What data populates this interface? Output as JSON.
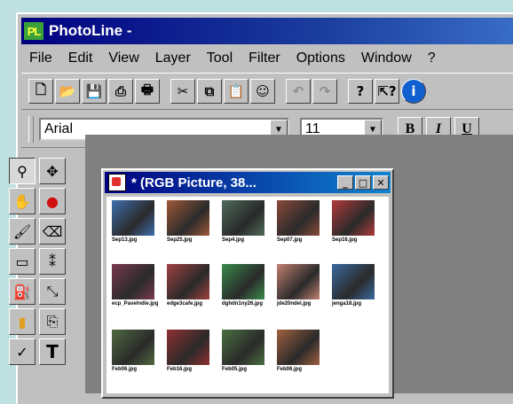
{
  "app": {
    "logo": "PL",
    "title": "PhotoLine -"
  },
  "menu": [
    "File",
    "Edit",
    "View",
    "Layer",
    "Tool",
    "Filter",
    "Options",
    "Window",
    "?"
  ],
  "toolbar": {
    "buttons": [
      {
        "name": "new-file-icon",
        "glyph": "🗋"
      },
      {
        "name": "open-folder-icon",
        "glyph": "📂"
      },
      {
        "name": "save-disk-icon",
        "glyph": "💾"
      },
      {
        "name": "scanner-icon",
        "glyph": "⎙"
      },
      {
        "name": "print-icon",
        "glyph": "🖶"
      },
      {
        "name": "cut-icon",
        "glyph": "✂"
      },
      {
        "name": "copy-icon",
        "glyph": "⧉"
      },
      {
        "name": "paste-icon",
        "glyph": "📋"
      },
      {
        "name": "paste-special-icon",
        "glyph": "☺"
      },
      {
        "name": "undo-icon",
        "glyph": "↶"
      },
      {
        "name": "redo-icon",
        "glyph": "↷"
      },
      {
        "name": "help-icon",
        "glyph": "?"
      },
      {
        "name": "context-help-icon",
        "glyph": "⇱?"
      },
      {
        "name": "info-icon",
        "glyph": "i"
      }
    ]
  },
  "font": {
    "family": "Arial",
    "size": "11",
    "bold": "B",
    "italic": "I",
    "underline": "U"
  },
  "tools": [
    {
      "name": "zoom-tool-icon",
      "glyph": "⚲"
    },
    {
      "name": "move-tool-icon",
      "glyph": "✥"
    },
    {
      "name": "hand-tool-icon",
      "glyph": "✋"
    },
    {
      "name": "lasso-tool-icon",
      "glyph": "●"
    },
    {
      "name": "brush-tool-icon",
      "glyph": "🖌"
    },
    {
      "name": "eraser-tool-icon",
      "glyph": "⌫"
    },
    {
      "name": "rect-select-tool-icon",
      "glyph": "▭"
    },
    {
      "name": "magic-wand-tool-icon",
      "glyph": "⁑"
    },
    {
      "name": "bucket-tool-icon",
      "glyph": "⛽"
    },
    {
      "name": "eyedropper-tool-icon",
      "glyph": "⤡"
    },
    {
      "name": "gradient-tool-icon",
      "glyph": "▮"
    },
    {
      "name": "clone-tool-icon",
      "glyph": "⎘"
    },
    {
      "name": "pen-tool-icon",
      "glyph": "✓"
    },
    {
      "name": "text-tool-icon",
      "glyph": "T"
    }
  ],
  "document": {
    "title": "* (RGB Picture, 38...",
    "minimize": "_",
    "maximize": "□",
    "close": "✕",
    "thumbnails": [
      {
        "caption": "Sep13.jpg",
        "color": "#3f6fb0"
      },
      {
        "caption": "Sep25.jpg",
        "color": "#a05a3a"
      },
      {
        "caption": "Sep4.jpg",
        "color": "#4e6a5a"
      },
      {
        "caption": "Sep07.jpg",
        "color": "#8a4a3a"
      },
      {
        "caption": "Sep16.jpg",
        "color": "#b23a3a"
      },
      {
        "caption": "ecp_Pavelndie.jpg",
        "color": "#7a3a50"
      },
      {
        "caption": "edge3cafe.jpg",
        "color": "#a04040"
      },
      {
        "caption": "dghdn1ny26.jpg",
        "color": "#3a8a4a"
      },
      {
        "caption": "jde20ndel.jpg",
        "color": "#c08070"
      },
      {
        "caption": "jenga18.jpg",
        "color": "#3a6aa0"
      },
      {
        "caption": "Feb06.jpg",
        "color": "#506a40"
      },
      {
        "caption": "Feb16.jpg",
        "color": "#903030"
      },
      {
        "caption": "Feb05.jpg",
        "color": "#4a7040"
      },
      {
        "caption": "Feb06.jpg",
        "color": "#a06040"
      }
    ]
  }
}
